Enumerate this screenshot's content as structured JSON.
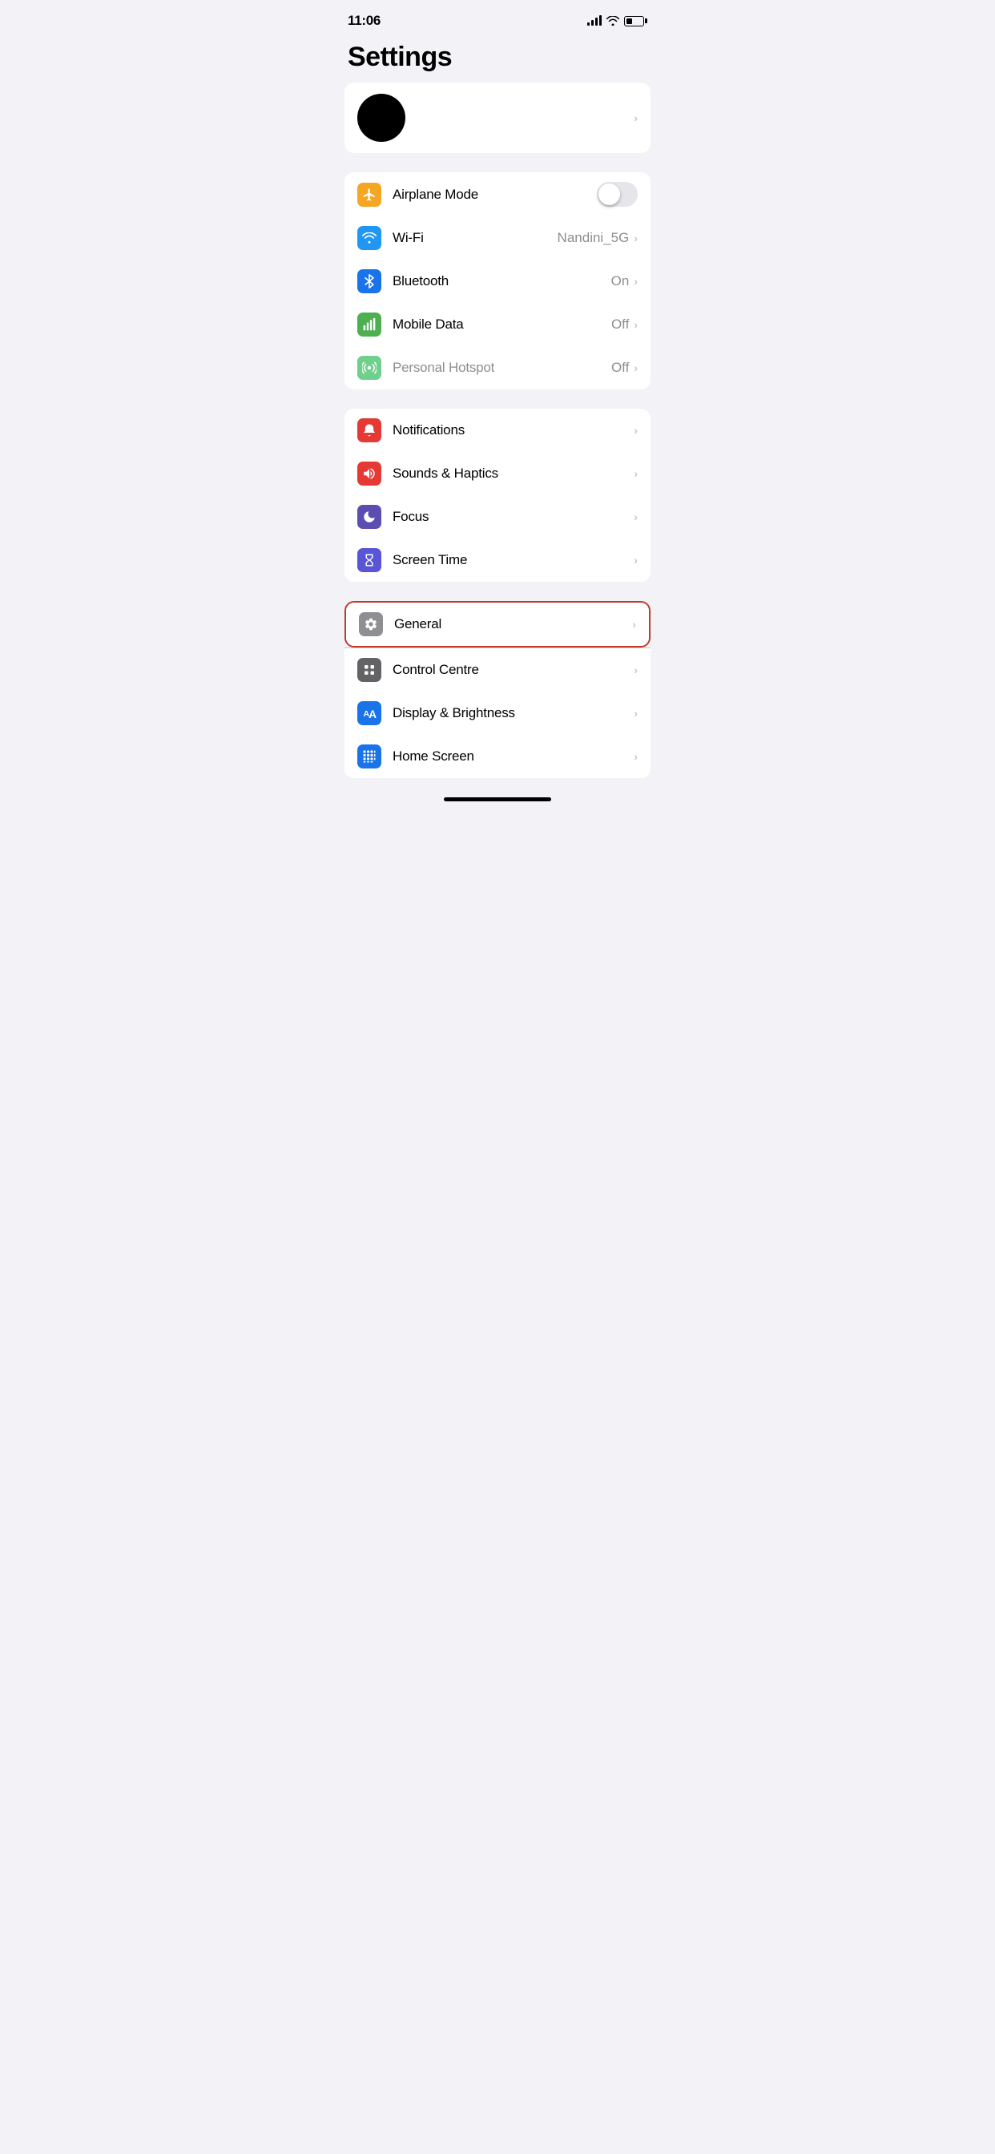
{
  "statusBar": {
    "time": "11:06",
    "signal": "full",
    "wifi": "on",
    "battery": "low"
  },
  "pageTitle": "Settings",
  "profileSection": {
    "chevron": "›"
  },
  "connectivitySection": {
    "rows": [
      {
        "id": "airplane-mode",
        "label": "Airplane Mode",
        "iconColor": "icon-orange",
        "iconSymbol": "airplane",
        "hasToggle": true,
        "toggleOn": false,
        "value": "",
        "hasChevron": false
      },
      {
        "id": "wifi",
        "label": "Wi-Fi",
        "iconColor": "icon-blue",
        "iconSymbol": "wifi",
        "hasToggle": false,
        "toggleOn": false,
        "value": "Nandini_5G",
        "hasChevron": true
      },
      {
        "id": "bluetooth",
        "label": "Bluetooth",
        "iconColor": "icon-bluetooth",
        "iconSymbol": "bluetooth",
        "hasToggle": false,
        "toggleOn": false,
        "value": "On",
        "hasChevron": true
      },
      {
        "id": "mobile-data",
        "label": "Mobile Data",
        "iconColor": "icon-green",
        "iconSymbol": "cellular",
        "hasToggle": false,
        "toggleOn": false,
        "value": "Off",
        "hasChevron": true
      },
      {
        "id": "personal-hotspot",
        "label": "Personal Hotspot",
        "iconColor": "icon-green-light",
        "iconSymbol": "hotspot",
        "hasToggle": false,
        "toggleOn": false,
        "value": "Off",
        "hasChevron": true,
        "labelDisabled": true
      }
    ]
  },
  "notificationsSection": {
    "rows": [
      {
        "id": "notifications",
        "label": "Notifications",
        "iconColor": "icon-red",
        "iconSymbol": "bell",
        "value": "",
        "hasChevron": true
      },
      {
        "id": "sounds-haptics",
        "label": "Sounds & Haptics",
        "iconColor": "icon-red-sound",
        "iconSymbol": "speaker",
        "value": "",
        "hasChevron": true
      },
      {
        "id": "focus",
        "label": "Focus",
        "iconColor": "icon-purple",
        "iconSymbol": "moon",
        "value": "",
        "hasChevron": true
      },
      {
        "id": "screen-time",
        "label": "Screen Time",
        "iconColor": "icon-purple-screen",
        "iconSymbol": "hourglass",
        "value": "",
        "hasChevron": true
      }
    ]
  },
  "generalSection": {
    "general": {
      "id": "general",
      "label": "General",
      "iconColor": "icon-gray",
      "iconSymbol": "gear",
      "value": "",
      "hasChevron": true
    },
    "rows": [
      {
        "id": "control-centre",
        "label": "Control Centre",
        "iconColor": "icon-gray2",
        "iconSymbol": "sliders",
        "value": "",
        "hasChevron": true
      },
      {
        "id": "display-brightness",
        "label": "Display & Brightness",
        "iconColor": "icon-blue-display",
        "iconSymbol": "text-size",
        "value": "",
        "hasChevron": true
      },
      {
        "id": "home-screen",
        "label": "Home Screen",
        "iconColor": "icon-blue-home",
        "iconSymbol": "grid",
        "value": "",
        "hasChevron": true
      }
    ]
  },
  "chevron": "›",
  "labels": {
    "bluetooth_value": "On",
    "wifi_value": "Nandini_5G",
    "mobile_data_value": "Off",
    "personal_hotspot_value": "Off"
  }
}
